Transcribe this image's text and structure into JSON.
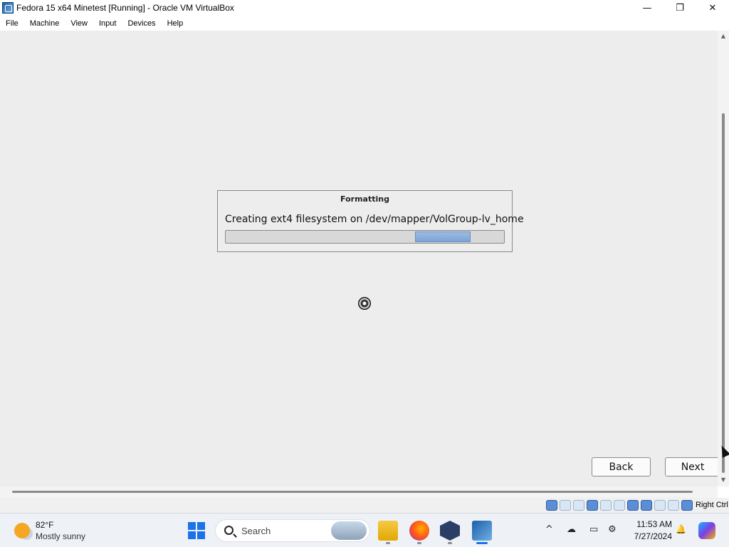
{
  "window": {
    "title": "Fedora 15 x64 Minetest [Running] - Oracle VM VirtualBox",
    "controls": {
      "minimize": "—",
      "maximize": "❐",
      "close": "✕"
    }
  },
  "menu": {
    "items": [
      "File",
      "Machine",
      "View",
      "Input",
      "Devices",
      "Help"
    ]
  },
  "vm": {
    "dialog": {
      "title": "Formatting",
      "message": "Creating ext4 filesystem on /dev/mapper/VolGroup-lv_home",
      "progress_indicator": "indeterminate"
    },
    "buttons": {
      "back": "Back",
      "next": "Next"
    }
  },
  "statusbar": {
    "host_key_label": "Right Ctrl",
    "icons": [
      "hard-disk-icon",
      "optical-drive-icon",
      "audio-icon",
      "network-icon",
      "usb-icon",
      "shared-folders-icon",
      "display-icon",
      "video-capture-icon",
      "vt-x-icon",
      "mouse-integration-icon",
      "keyboard-capture-icon"
    ]
  },
  "taskbar": {
    "weather": {
      "temp": "82°F",
      "condition": "Mostly sunny"
    },
    "search_placeholder": "Search",
    "apps": [
      "file-explorer-icon",
      "firefox-icon",
      "virtualbox-icon",
      "fedora-vm-icon"
    ],
    "clock": {
      "time": "11:53 AM",
      "date": "7/27/2024"
    },
    "tray": {
      "chevron": "^",
      "bell": "🔔"
    }
  },
  "colors": {
    "vm_background": "#ededed",
    "progress_fill": "#7ca3d6",
    "accent": "#1a73e8"
  }
}
